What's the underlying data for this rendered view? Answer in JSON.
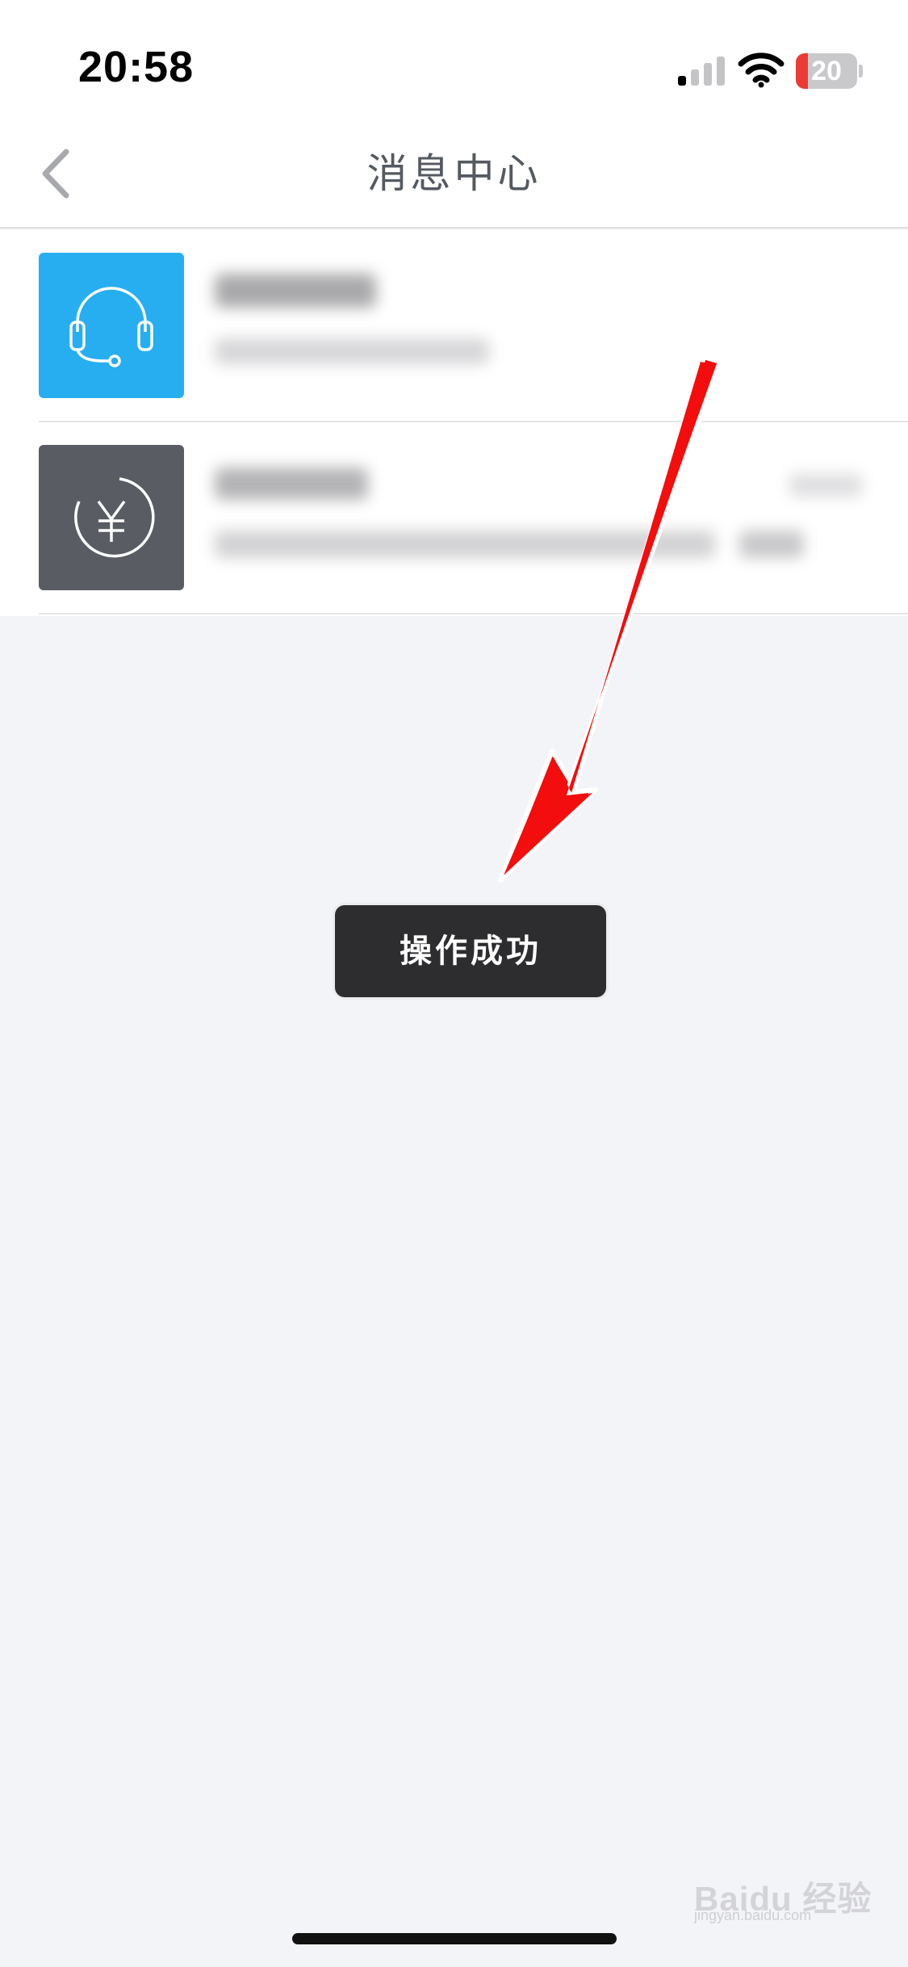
{
  "status_bar": {
    "time": "20:58",
    "battery_level": "20",
    "battery_fraction": 0.2,
    "signal_icon": "cellular-signal-icon",
    "wifi_icon": "wifi-icon",
    "battery_color": "#ec3b35"
  },
  "nav": {
    "back_icon": "chevron-left-icon",
    "title": "消息中心"
  },
  "messages": [
    {
      "icon": "headset-icon",
      "icon_bg": "#27aef1",
      "title": "",
      "subtitle": "",
      "time": ""
    },
    {
      "icon": "yen-circle-icon",
      "icon_bg": "#595c63",
      "title": "",
      "subtitle": "",
      "time": ""
    }
  ],
  "toast": {
    "text": "操作成功"
  },
  "annotation": {
    "icon": "red-arrow-icon",
    "color": "#f40d0d"
  },
  "watermark": {
    "text": "Baidu 经验",
    "sub": "jingyan.baidu.com"
  }
}
